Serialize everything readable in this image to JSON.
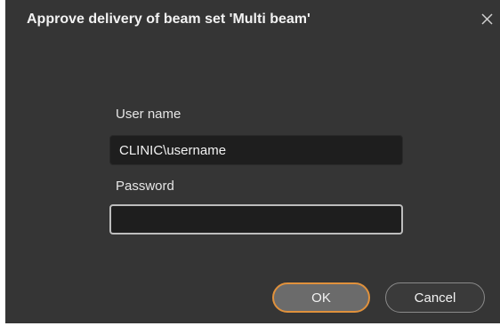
{
  "dialog": {
    "title": "Approve delivery of beam set 'Multi beam'",
    "close_icon": "close-icon"
  },
  "form": {
    "username_label": "User name",
    "username_value": "CLINIC\\username",
    "password_label": "Password",
    "password_value": ""
  },
  "buttons": {
    "ok_label": "OK",
    "cancel_label": "Cancel"
  },
  "colors": {
    "background": "#353535",
    "field_bg": "#1e1e1e",
    "focus_border": "#e0913c",
    "ok_bg": "#6b6b6b"
  }
}
